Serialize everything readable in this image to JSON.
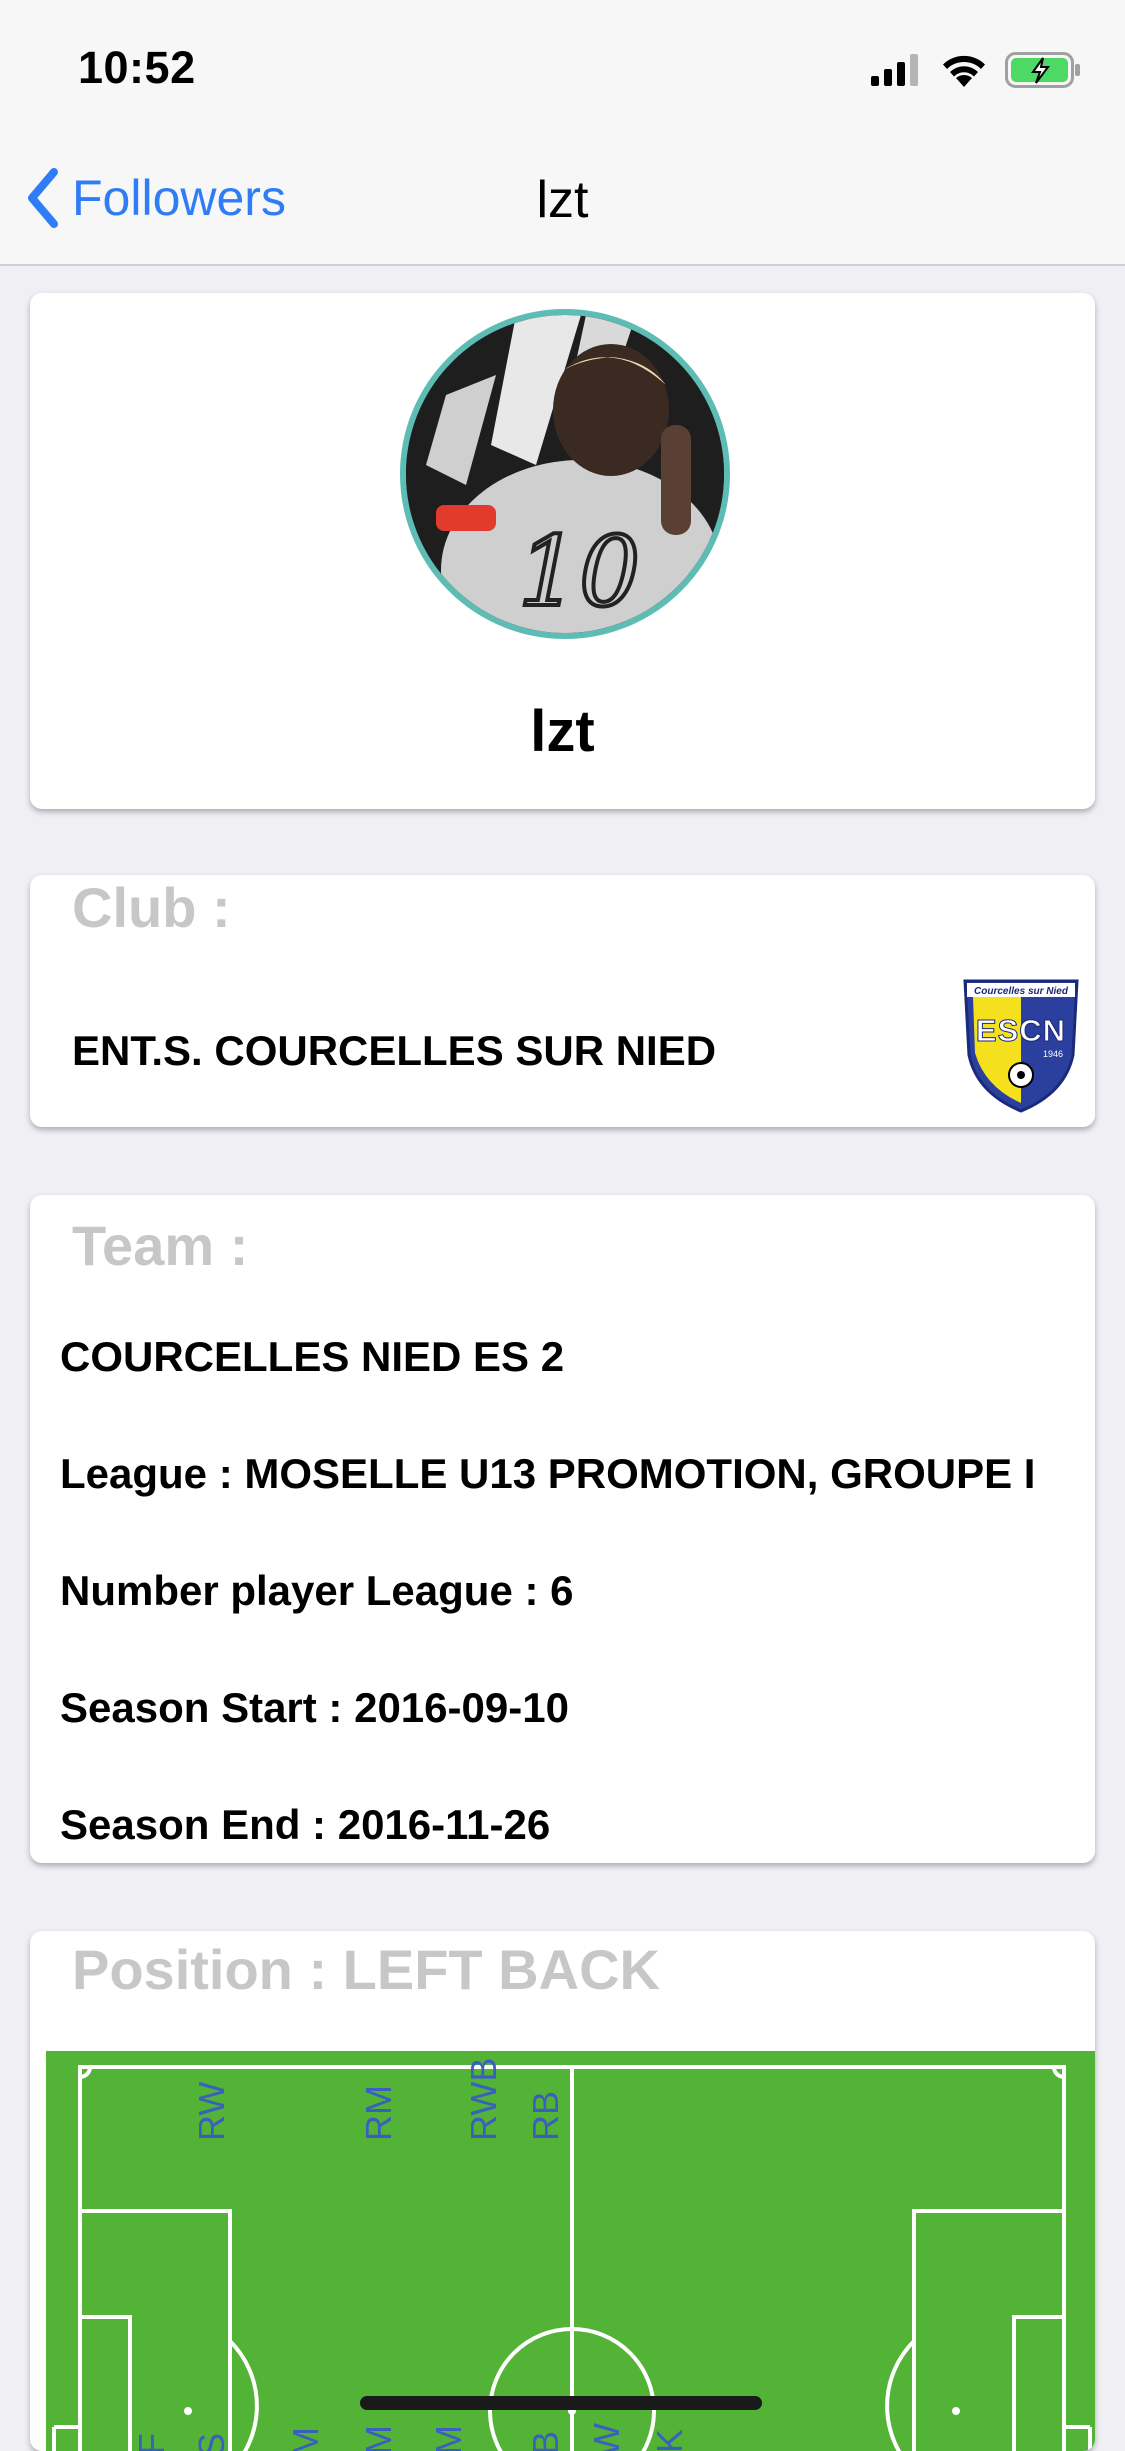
{
  "status_bar": {
    "time": "10:52",
    "icons": [
      "signal-icon",
      "wifi-icon",
      "battery-charging-icon"
    ],
    "battery_color": "#4cd964"
  },
  "nav": {
    "back_label": "Followers",
    "title": "lzt"
  },
  "profile": {
    "name": "lzt",
    "avatar_ring_color": "#5dbdb4",
    "jersey_text": "10"
  },
  "club": {
    "label": "Club :",
    "name": "ENT.S. COURCELLES SUR NIED",
    "logo": {
      "top_text": "Courcelles sur Nied",
      "letters": "ESCN",
      "year": "1946"
    }
  },
  "team": {
    "label": "Team :",
    "name": "COURCELLES NIED ES 2",
    "league": "League : MOSELLE U13 PROMOTION, GROUPE I",
    "number_players": "Number player League :  6",
    "season_start": "Season Start :  2016-09-10",
    "season_end": "Season End :  2016-11-26"
  },
  "position": {
    "label": "Position : LEFT BACK",
    "pitch_color": "#52b336",
    "labels_top": [
      "RW",
      "RM",
      "RWB",
      "RB"
    ],
    "labels_bottom": [
      "CF",
      "SS",
      "AM",
      "CM",
      "DM",
      "CB",
      "SW",
      "GK"
    ],
    "label_color": "#3a5fbf"
  },
  "accent_color": "#2f7df6"
}
